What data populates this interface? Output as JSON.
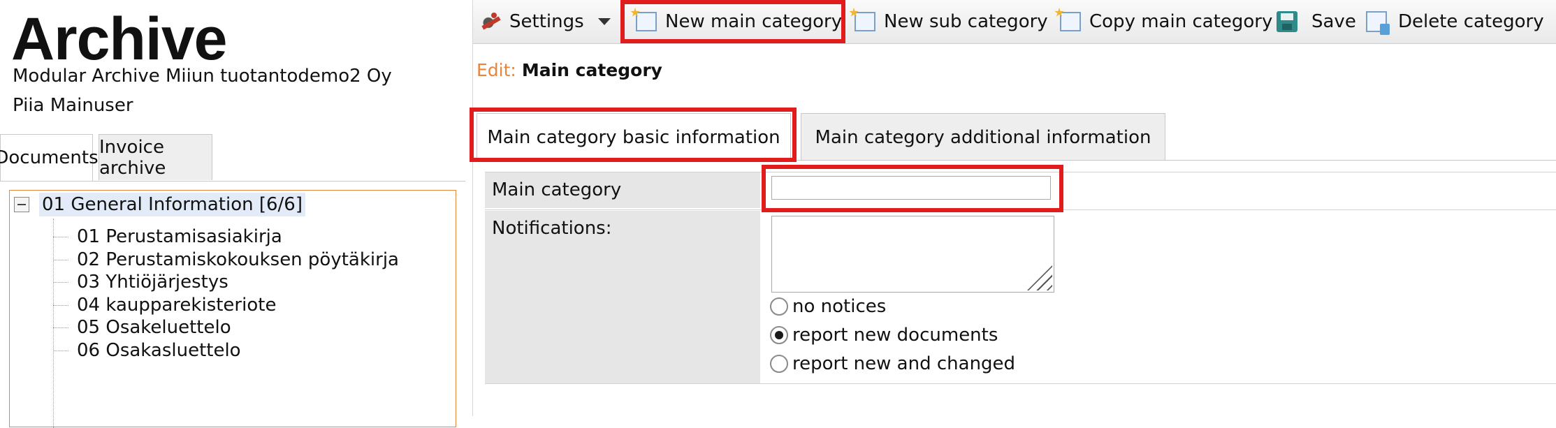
{
  "header": {
    "app_title": "Archive",
    "company": "Modular Archive Miiun tuotantodemo2 Oy",
    "user": "Piia Mainuser"
  },
  "left_tabs": [
    "Documents",
    "Invoice archive"
  ],
  "tree": {
    "root": "01 General Information [6/6]",
    "items": [
      "01 Perustamisasiakirja",
      "02 Perustamiskokouksen pöytäkirja",
      "03 Yhtiöjärjestys",
      "04 kaupparekisteriote",
      "05 Osakeluettelo",
      "06 Osakasluettelo"
    ]
  },
  "toolbar": {
    "settings": "Settings",
    "new_main_category": "New main category",
    "new_sub_category": "New sub category",
    "copy_main_category": "Copy main category",
    "save": "Save",
    "delete_category": "Delete category"
  },
  "edit": {
    "prefix": "Edit:",
    "name": "Main category"
  },
  "tabs": [
    "Main category basic information",
    "Main category additional information"
  ],
  "form": {
    "main_category_label": "Main category",
    "main_category_value": "",
    "notifications_label": "Notifications:",
    "notification_options": [
      "no notices",
      "report new documents",
      "report new and changed"
    ],
    "selected_notification": "report new documents"
  },
  "colors": {
    "highlight": "#e01c1c",
    "edit_prefix": "#e8853c",
    "tree_border": "#e8853c"
  }
}
